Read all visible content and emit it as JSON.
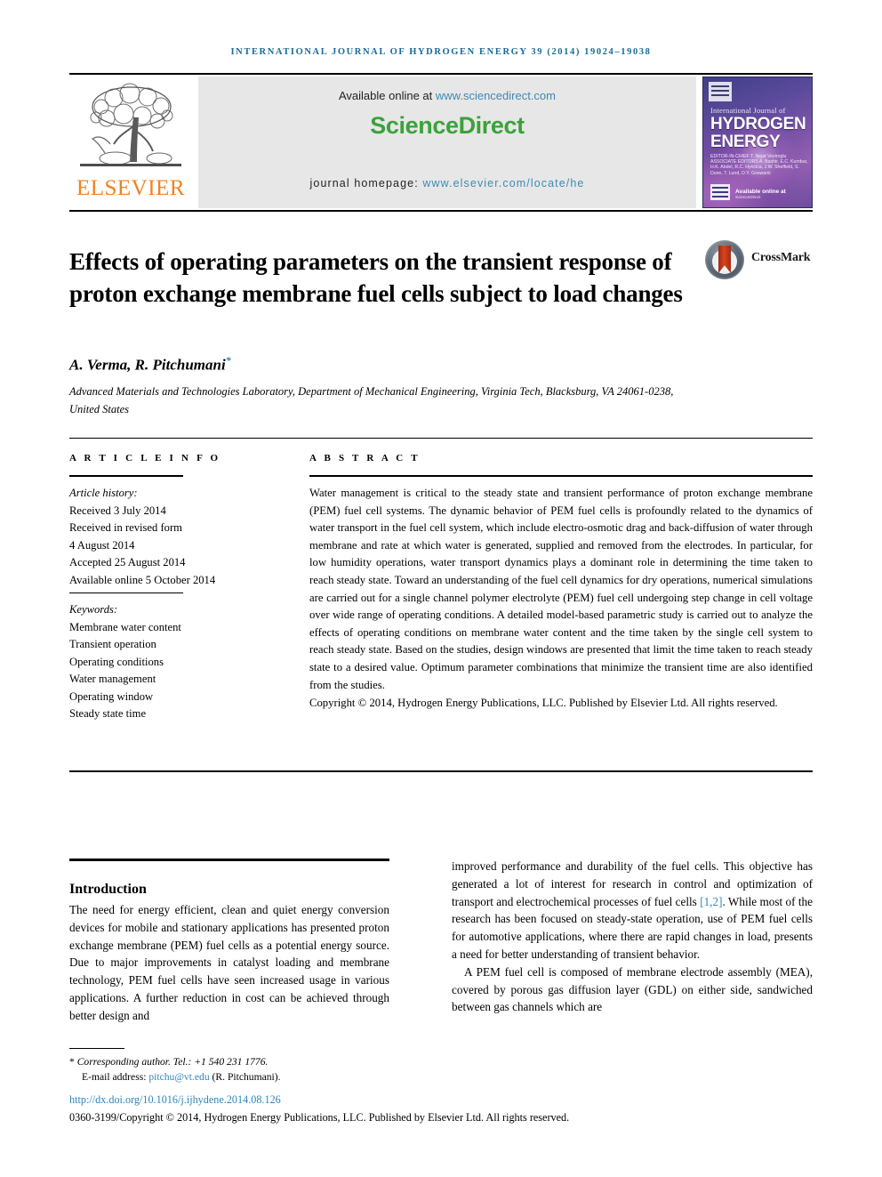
{
  "running_head": "INTERNATIONAL JOURNAL OF HYDROGEN ENERGY 39 (2014) 19024–19038",
  "colors": {
    "link_blue": "#2f87b7",
    "running_head_blue": "#1b6a96",
    "sciencedirect_green": "#3ba23b",
    "elsevier_orange": "#f08221",
    "crossmark_red": "#d8431d"
  },
  "masthead": {
    "publisher_name": "ELSEVIER",
    "available_prefix": "Available online at ",
    "available_url": "www.sciencedirect.com",
    "sciencedirect_logo": "ScienceDirect",
    "homepage_prefix": "journal homepage: ",
    "homepage_url": "www.elsevier.com/locate/he",
    "cover": {
      "line1": "International Journal of",
      "word1": "HYDROGEN",
      "word2": "ENERGY",
      "editors": "EDITOR-IN-CHIEF  T. Nejat Veziroglu    ASSOCIATE EDITORS  A. Bashir, E.C. Kumbur, H.K. Abdel, R.C. Hyncica, J.W. Sheffield, S. Dunn, T. Lund, D.Y. Goswami",
      "sciencedirect_label": "Available online at",
      "sciencedirect_sub": "ScienceDirect"
    }
  },
  "article": {
    "title": "Effects of operating parameters on the transient response of proton exchange membrane fuel cells subject to load changes",
    "crossmark_label": "CrossMark",
    "authors": "A. Verma, R. Pitchumani",
    "corresponding_marker": "*",
    "affiliation": "Advanced Materials and Technologies Laboratory, Department of Mechanical Engineering, Virginia Tech, Blacksburg, VA 24061-0238, United States"
  },
  "info": {
    "label": "A R T I C L E  I N F O",
    "history_label": "Article history:",
    "history": [
      "Received 3 July 2014",
      "Received in revised form",
      "4 August 2014",
      "Accepted 25 August 2014",
      "Available online 5 October 2014"
    ],
    "keywords_label": "Keywords:",
    "keywords": [
      "Membrane water content",
      "Transient operation",
      "Operating conditions",
      "Water management",
      "Operating window",
      "Steady state time"
    ]
  },
  "abstract": {
    "label": "A B S T R A C T",
    "body": "Water management is critical to the steady state and transient performance of proton exchange membrane (PEM) fuel cell systems. The dynamic behavior of PEM fuel cells is profoundly related to the dynamics of water transport in the fuel cell system, which include electro-osmotic drag and back-diffusion of water through membrane and rate at which water is generated, supplied and removed from the electrodes. In particular, for low humidity operations, water transport dynamics plays a dominant role in determining the time taken to reach steady state. Toward an understanding of the fuel cell dynamics for dry operations, numerical simulations are carried out for a single channel polymer electrolyte (PEM) fuel cell undergoing step change in cell voltage over wide range of operating conditions. A detailed model-based parametric study is carried out to analyze the effects of operating conditions on membrane water content and the time taken by the single cell system to reach steady state. Based on the studies, design windows are presented that limit the time taken to reach steady state to a desired value. Optimum parameter combinations that minimize the transient time are also identified from the studies.",
    "copyright": "Copyright © 2014, Hydrogen Energy Publications, LLC. Published by Elsevier Ltd. All rights reserved."
  },
  "body": {
    "section_heading": "Introduction",
    "left_paragraph": "The need for energy efficient, clean and quiet energy conversion devices for mobile and stationary applications has presented proton exchange membrane (PEM) fuel cells as a potential energy source. Due to major improvements in catalyst loading and membrane technology, PEM fuel cells have seen increased usage in various applications. A further reduction in cost can be achieved through better design and",
    "right_paragraph_1a": "improved performance and durability of the fuel cells. This objective has generated a lot of interest for research in control and optimization of transport and electrochemical processes of fuel cells ",
    "right_citation": "[1,2]",
    "right_paragraph_1b": ". While most of the research has been focused on steady-state operation, use of PEM fuel cells for automotive applications, where there are rapid changes in load, presents a need for better understanding of transient behavior.",
    "right_paragraph_2": "A PEM fuel cell is composed of membrane electrode assembly (MEA), covered by porous gas diffusion layer (GDL) on either side, sandwiched between gas channels which are"
  },
  "footer": {
    "corresponding_marker": "*",
    "corresponding_text": " Corresponding author. Tel.: +1 540 231 1776.",
    "email_label": "E-mail address: ",
    "email": "pitchu@vt.edu",
    "email_suffix": " (R. Pitchumani).",
    "doi": "http://dx.doi.org/10.1016/j.ijhydene.2014.08.126",
    "issn_line": "0360-3199/Copyright © 2014, Hydrogen Energy Publications, LLC. Published by Elsevier Ltd. All rights reserved."
  }
}
